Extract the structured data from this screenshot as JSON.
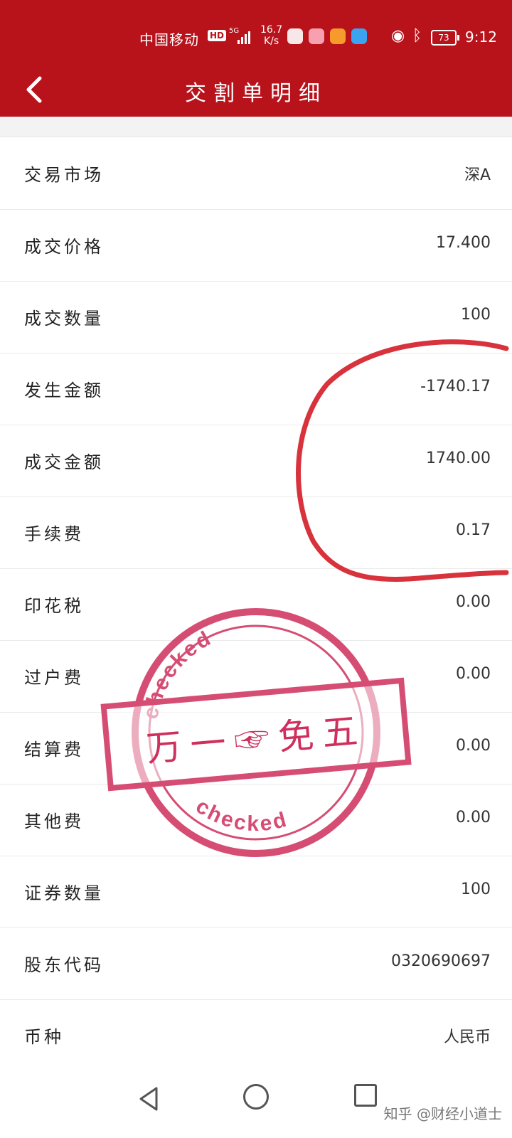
{
  "status_bar": {
    "carrier": "中国移动",
    "hd": "HD",
    "network": "5G",
    "speed_value": "16.7",
    "speed_unit": "K/s",
    "battery": "73",
    "time": "9:12"
  },
  "header": {
    "title": "交割单明细",
    "back_icon": "chevron-left-icon",
    "background": "#b8121b"
  },
  "rows": [
    {
      "label": "交易市场",
      "value": "深A"
    },
    {
      "label": "成交价格",
      "value": "17.400"
    },
    {
      "label": "成交数量",
      "value": "100"
    },
    {
      "label": "发生金额",
      "value": "-1740.17"
    },
    {
      "label": "成交金额",
      "value": "1740.00"
    },
    {
      "label": "手续费",
      "value": "0.17"
    },
    {
      "label": "印花税",
      "value": "0.00"
    },
    {
      "label": "过户费",
      "value": "0.00"
    },
    {
      "label": "结算费",
      "value": "0.00"
    },
    {
      "label": "其他费",
      "value": "0.00"
    },
    {
      "label": "证券数量",
      "value": "100"
    },
    {
      "label": "股东代码",
      "value": "0320690697"
    },
    {
      "label": "币种",
      "value": "人民币"
    }
  ],
  "stamp": {
    "ring_text": "checked",
    "center_text": "万一☞免五",
    "color": "#cf2f5c"
  },
  "annotation_color": "#d8323c",
  "watermark": "知乎 @财经小道士",
  "nav": {
    "back_icon": "triangle-back-icon",
    "home_icon": "circle-home-icon",
    "recent_icon": "square-recent-icon"
  }
}
